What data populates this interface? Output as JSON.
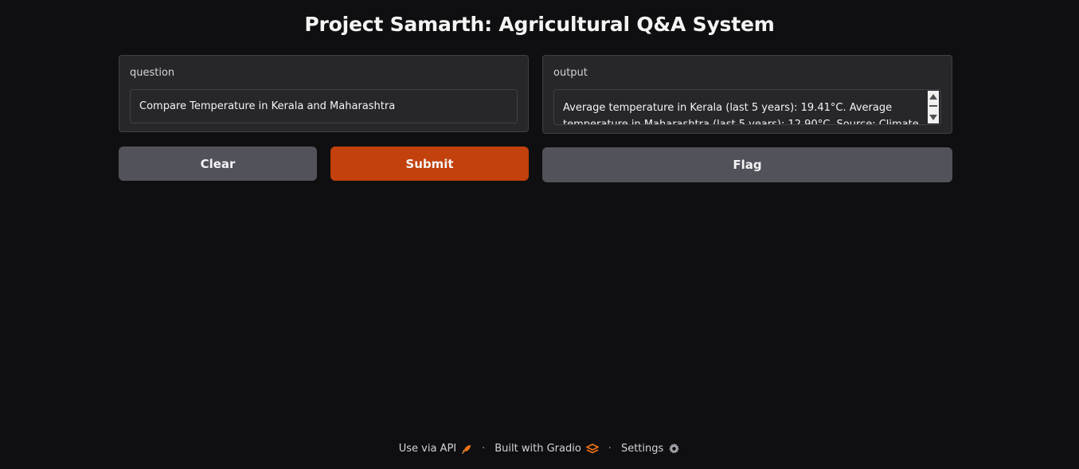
{
  "title": "Project Samarth: Agricultural Q&A System",
  "question": {
    "label": "question",
    "value": "Compare Temperature in Kerala and Maharashtra"
  },
  "output": {
    "label": "output",
    "value": "Average temperature in Kerala (last 5 years): 19.41°C. Average temperature in Maharashtra (last 5 years): 12.90°C. Source: Climate"
  },
  "buttons": {
    "clear": "Clear",
    "submit": "Submit",
    "flag": "Flag"
  },
  "footer": {
    "api": "Use via API",
    "built": "Built with Gradio",
    "settings": "Settings",
    "separator": "·"
  },
  "colors": {
    "background": "#0f0f11",
    "panel": "#27272a",
    "primary": "#c2410c",
    "secondary": "#52525b",
    "gradio_icon": "#f97316"
  },
  "icons": {
    "api": "rocket-icon",
    "gradio": "gradio-logo-icon",
    "settings": "gear-icon"
  }
}
